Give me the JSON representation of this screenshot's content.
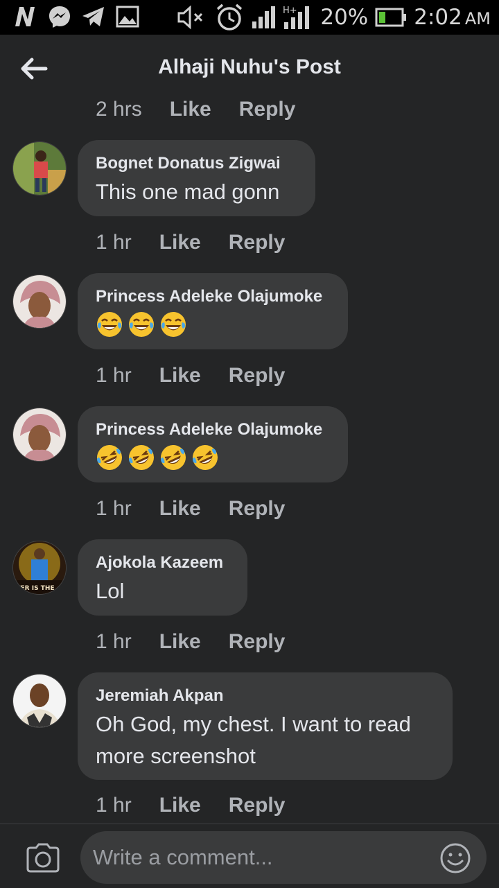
{
  "status_bar": {
    "battery_percent": "20%",
    "time": "2:02",
    "ampm": "AM",
    "network_label": "H+",
    "icons": [
      "n-app-icon",
      "messenger-icon",
      "telegram-icon",
      "gallery-icon",
      "mute-icon",
      "alarm-icon",
      "signal-icon",
      "signal-hplus-icon",
      "battery-icon"
    ]
  },
  "header": {
    "title": "Alhaji Nuhu's Post",
    "back_icon": "arrow-left-icon"
  },
  "actions": {
    "like": "Like",
    "reply": "Reply"
  },
  "top_meta": {
    "time": "2 hrs"
  },
  "comments": [
    {
      "author": "Bognet Donatus Zigwai",
      "text": "This one mad gonn",
      "time": "1 hr"
    },
    {
      "author": "Princess Adeleke Olajumoke",
      "emoji": [
        "face-with-tears-of-joy",
        "face-with-tears-of-joy",
        "face-with-tears-of-joy"
      ],
      "time": "1 hr"
    },
    {
      "author": "Princess Adeleke Olajumoke",
      "emoji": [
        "rolling-on-floor-laughing",
        "rolling-on-floor-laughing",
        "rolling-on-floor-laughing",
        "rolling-on-floor-laughing"
      ],
      "time": "1 hr"
    },
    {
      "author": "Ajokola Kazeem",
      "text": "Lol",
      "time": "1 hr",
      "avatar_caption": "YER IS THE"
    },
    {
      "author": "Jeremiah Akpan",
      "text_line1": "Oh God, my chest. I want to read",
      "text_line2": "more screenshot",
      "time": "1 hr"
    }
  ],
  "composer": {
    "placeholder": "Write a comment...",
    "camera_icon": "camera-icon",
    "emoji_icon": "smiley-icon"
  },
  "colors": {
    "background": "#242526",
    "bubble": "#3a3b3c",
    "text": "#e4e6eb",
    "muted": "#b0b3b8"
  }
}
